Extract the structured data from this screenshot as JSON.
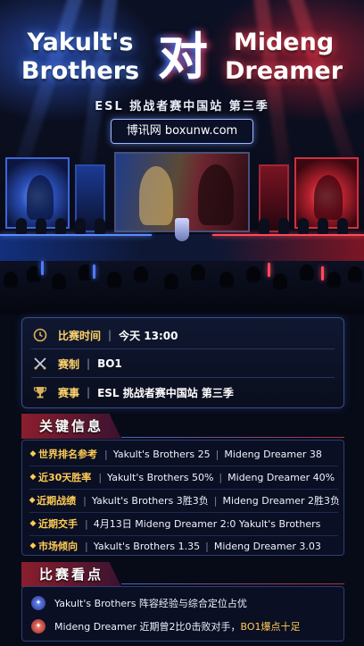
{
  "header": {
    "team_left_line1": "Yakult's",
    "team_left_line2": "Brothers",
    "vs_text": "对",
    "team_right_line1": "Mideng",
    "team_right_line2": "Dreamer",
    "subtitle": "ESL 挑战者赛中国站 第三季",
    "site_tag": "博讯网 boxunw.com"
  },
  "info": [
    {
      "icon": "clock-icon",
      "label": "比赛时间",
      "value": "今天 13:00"
    },
    {
      "icon": "swords-icon",
      "label": "赛制",
      "value": "BO1"
    },
    {
      "icon": "trophy-icon",
      "label": "赛事",
      "value": "ESL 挑战者赛中国站 第三季"
    }
  ],
  "key_info": {
    "title": "关键信息",
    "rows": [
      {
        "label": "世界排名参考",
        "left": "Yakult's Brothers 25",
        "right": "Mideng Dreamer 38"
      },
      {
        "label": "近30天胜率",
        "left": "Yakult's Brothers 50%",
        "right": "Mideng Dreamer 40%"
      },
      {
        "label": "近期战绩",
        "left": "Yakult's Brothers 3胜3负",
        "right": "Mideng Dreamer 2胜3负"
      },
      {
        "label": "近期交手",
        "left": "4月13日 Mideng Dreamer 2:0 Yakult's Brothers",
        "right": ""
      },
      {
        "label": "市场倾向",
        "left": "Yakult's Brothers 1.35",
        "right": "Mideng Dreamer 3.03"
      }
    ]
  },
  "highlights": {
    "title": "比赛看点",
    "rows": [
      {
        "icon": "shield-emblem-icon",
        "text": "Yakult's Brothers 阵容经验与综合定位占优",
        "accent": ""
      },
      {
        "icon": "fire-emblem-icon",
        "text": "Mideng Dreamer 近期曾2比0击败对手，",
        "accent": "BO1爆点十足"
      }
    ]
  },
  "colors": {
    "blue_accent": "#5b8cff",
    "red_accent": "#ff4a5c",
    "gold_label": "#ffcc55"
  }
}
